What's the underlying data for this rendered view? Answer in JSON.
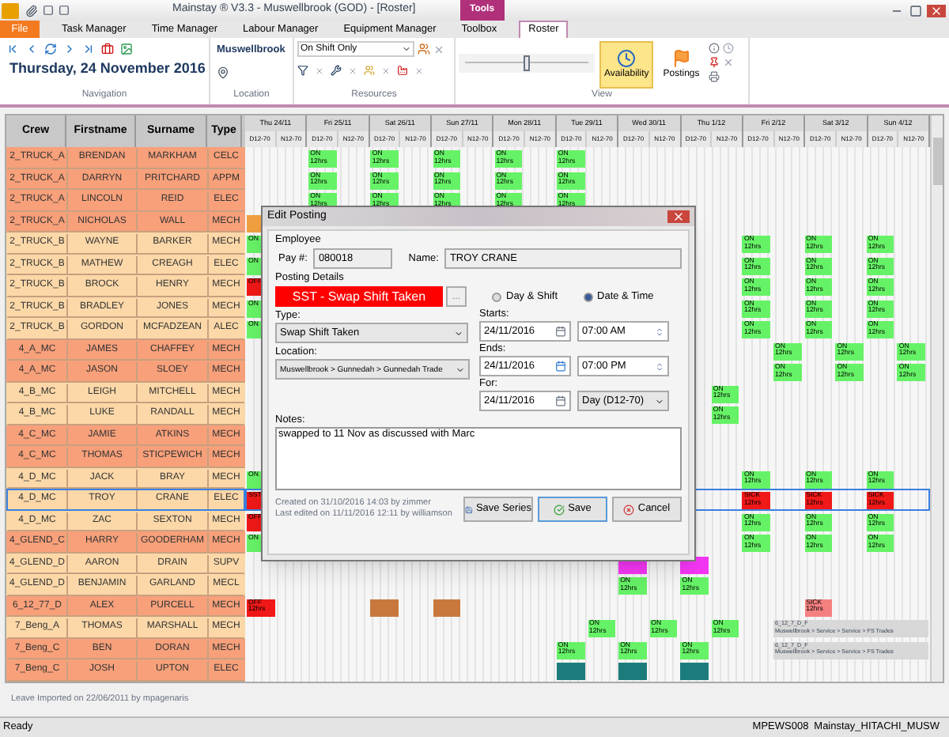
{
  "window": {
    "title": "Mainstay ® V3.3 - Muswellbrook (GOD) - [Roster]",
    "context_tab": "Tools"
  },
  "tabs": [
    {
      "label": "File",
      "kind": "file",
      "selected": false
    },
    {
      "label": "Task Manager",
      "kind": "tab",
      "selected": false
    },
    {
      "label": "Time Manager",
      "kind": "tab",
      "selected": false
    },
    {
      "label": "Labour Manager",
      "kind": "tab",
      "selected": false
    },
    {
      "label": "Equipment Manager",
      "kind": "tab",
      "selected": false
    },
    {
      "label": "Toolbox",
      "kind": "tab",
      "selected": false
    },
    {
      "label": "Roster",
      "kind": "tab",
      "selected": true
    }
  ],
  "ribbon": {
    "date": "Thursday, 24 November 2016",
    "location": "Muswellbrook",
    "resource_filter": "On Shift Only",
    "view_buttons": [
      {
        "label": "Availability",
        "selected": true
      },
      {
        "label": "Postings",
        "selected": false
      }
    ],
    "zoom_slider": {
      "level": 0.5
    },
    "groups": [
      "Navigation",
      "Location",
      "Resources",
      "View"
    ]
  },
  "table": {
    "columns": [
      "Crew",
      "Firstname",
      "Surname",
      "Type"
    ],
    "days": [
      {
        "label": "Thu 24/11",
        "shifts": [
          "D12-70",
          "N12-70"
        ]
      },
      {
        "label": "Fri 25/11",
        "shifts": [
          "D12-70",
          "N12-70"
        ]
      },
      {
        "label": "Sat 26/11",
        "shifts": [
          "D12-70",
          "N12-70"
        ]
      },
      {
        "label": "Sun 27/11",
        "shifts": [
          "D12-70",
          "N12-70"
        ]
      },
      {
        "label": "Mon 28/11",
        "shifts": [
          "D12-70",
          "N12-70"
        ]
      },
      {
        "label": "Tue 29/11",
        "shifts": [
          "D12-70",
          "N12-70"
        ]
      },
      {
        "label": "Wed 30/11",
        "shifts": [
          "D12-70",
          "N12-70"
        ]
      },
      {
        "label": "Thu 1/12",
        "shifts": [
          "D12-70",
          "N12-70"
        ]
      },
      {
        "label": "Fri 2/12",
        "shifts": [
          "D12-70",
          "N12-70"
        ]
      },
      {
        "label": "Sat 3/12",
        "shifts": [
          "D12-70",
          "N12-70"
        ]
      },
      {
        "label": "Sun 4/12",
        "shifts": [
          "D12-70",
          "N12-70"
        ]
      }
    ],
    "rows": [
      {
        "crew": "2_TRUCK_A",
        "firstname": "BRENDAN",
        "surname": "MARKHAM",
        "type": "CELC",
        "color": "#f7a07a",
        "selected": false,
        "cells": [
          null,
          null,
          {
            "kind": "on",
            "label": "ON 12hrs"
          },
          null,
          {
            "kind": "on",
            "label": "ON 12hrs"
          },
          null,
          {
            "kind": "on",
            "label": "ON 12hrs"
          },
          null,
          {
            "kind": "on",
            "label": "ON 12hrs"
          },
          null,
          {
            "kind": "on",
            "label": "ON 12hrs"
          },
          null,
          null,
          null,
          null,
          null,
          null,
          null,
          null,
          null,
          null,
          null
        ]
      },
      {
        "crew": "2_TRUCK_A",
        "firstname": "DARRYN",
        "surname": "PRITCHARD",
        "type": "APPM",
        "color": "#f7a07a",
        "selected": false,
        "cells": [
          null,
          null,
          {
            "kind": "on",
            "label": "ON 12hrs"
          },
          null,
          {
            "kind": "on",
            "label": "ON 12hrs"
          },
          null,
          {
            "kind": "on",
            "label": "ON 12hrs"
          },
          null,
          {
            "kind": "on",
            "label": "ON 12hrs"
          },
          null,
          {
            "kind": "on",
            "label": "ON 12hrs"
          },
          null,
          null,
          null,
          null,
          null,
          null,
          null,
          null,
          null,
          null,
          null
        ]
      },
      {
        "crew": "2_TRUCK_A",
        "firstname": "LINCOLN",
        "surname": "REID",
        "type": "ELEC",
        "color": "#f7a07a",
        "selected": false,
        "cells": [
          null,
          null,
          {
            "kind": "on",
            "label": "ON 12hrs"
          },
          null,
          {
            "kind": "on",
            "label": "ON 12hrs"
          },
          null,
          {
            "kind": "on",
            "label": "ON 12hrs"
          },
          null,
          {
            "kind": "on",
            "label": "ON 12hrs"
          },
          null,
          {
            "kind": "on",
            "label": "ON 12hrs"
          },
          null,
          null,
          null,
          null,
          null,
          null,
          null,
          null,
          null,
          null,
          null
        ]
      },
      {
        "crew": "2_TRUCK_A",
        "firstname": "NICHOLAS",
        "surname": "WALL",
        "type": "MECH",
        "color": "#f7a07a",
        "selected": false,
        "cells": [
          {
            "kind": "amber"
          },
          null,
          null,
          null,
          null,
          null,
          null,
          null,
          null,
          null,
          null,
          null,
          null,
          null,
          null,
          null,
          null,
          null,
          null,
          null,
          null,
          null
        ]
      },
      {
        "crew": "2_TRUCK_B",
        "firstname": "WAYNE",
        "surname": "BARKER",
        "type": "MECH",
        "color": "#fcd8a8",
        "selected": false,
        "cells": [
          {
            "kind": "on",
            "label": "ON"
          },
          null,
          null,
          null,
          null,
          null,
          null,
          null,
          null,
          null,
          null,
          null,
          null,
          null,
          null,
          null,
          {
            "kind": "on",
            "label": "ON 12hrs"
          },
          null,
          {
            "kind": "on",
            "label": "ON 12hrs"
          },
          null,
          {
            "kind": "on",
            "label": "ON 12hrs"
          },
          null
        ]
      },
      {
        "crew": "2_TRUCK_B",
        "firstname": "MATHEW",
        "surname": "CREAGH",
        "type": "ELEC",
        "color": "#fcd8a8",
        "selected": false,
        "cells": [
          {
            "kind": "on",
            "label": "ON"
          },
          null,
          null,
          null,
          null,
          null,
          null,
          null,
          null,
          null,
          null,
          null,
          null,
          null,
          null,
          null,
          {
            "kind": "on",
            "label": "ON 12hrs"
          },
          null,
          {
            "kind": "on",
            "label": "ON 12hrs"
          },
          null,
          {
            "kind": "on",
            "label": "ON 12hrs"
          },
          null
        ]
      },
      {
        "crew": "2_TRUCK_B",
        "firstname": "BROCK",
        "surname": "HENRY",
        "type": "MECH",
        "color": "#fcd8a8",
        "selected": false,
        "cells": [
          {
            "kind": "off",
            "label": "OFF"
          },
          null,
          null,
          null,
          null,
          null,
          null,
          null,
          null,
          null,
          null,
          null,
          null,
          null,
          null,
          null,
          {
            "kind": "on",
            "label": "ON 12hrs"
          },
          null,
          {
            "kind": "on",
            "label": "ON 12hrs"
          },
          null,
          {
            "kind": "on",
            "label": "ON 12hrs"
          },
          null
        ]
      },
      {
        "crew": "2_TRUCK_B",
        "firstname": "BRADLEY",
        "surname": "JONES",
        "type": "MECH",
        "color": "#fcd8a8",
        "selected": false,
        "cells": [
          {
            "kind": "on",
            "label": "ON"
          },
          null,
          null,
          null,
          null,
          null,
          null,
          null,
          null,
          null,
          null,
          null,
          null,
          null,
          null,
          null,
          {
            "kind": "on",
            "label": "ON 12hrs"
          },
          null,
          {
            "kind": "on",
            "label": "ON 12hrs"
          },
          null,
          {
            "kind": "on",
            "label": "ON 12hrs"
          },
          null
        ]
      },
      {
        "crew": "2_TRUCK_B",
        "firstname": "GORDON",
        "surname": "MCFADZEAN",
        "type": "ALEC",
        "color": "#fcd8a8",
        "selected": false,
        "cells": [
          {
            "kind": "on",
            "label": "ON"
          },
          null,
          null,
          null,
          null,
          null,
          null,
          null,
          null,
          null,
          null,
          null,
          null,
          null,
          null,
          null,
          {
            "kind": "on",
            "label": "ON 12hrs"
          },
          null,
          {
            "kind": "on",
            "label": "ON 12hrs"
          },
          null,
          {
            "kind": "on",
            "label": "ON 12hrs"
          },
          null
        ]
      },
      {
        "crew": "4_A_MC",
        "firstname": "JAMES",
        "surname": "CHAFFEY",
        "type": "MECH",
        "color": "#f7a07a",
        "selected": false,
        "cells": [
          null,
          null,
          null,
          null,
          null,
          null,
          null,
          null,
          null,
          null,
          null,
          null,
          null,
          null,
          null,
          null,
          null,
          {
            "kind": "on",
            "label": "ON 12hrs"
          },
          null,
          {
            "kind": "on",
            "label": "ON 12hrs"
          },
          null,
          {
            "kind": "on",
            "label": "ON 12hrs"
          }
        ]
      },
      {
        "crew": "4_A_MC",
        "firstname": "JASON",
        "surname": "SLOEY",
        "type": "MECH",
        "color": "#f7a07a",
        "selected": false,
        "cells": [
          null,
          null,
          null,
          null,
          null,
          null,
          null,
          null,
          null,
          null,
          null,
          null,
          null,
          null,
          null,
          null,
          null,
          {
            "kind": "on",
            "label": "ON 12hrs"
          },
          null,
          {
            "kind": "on",
            "label": "ON 12hrs"
          },
          null,
          {
            "kind": "on",
            "label": "ON 12hrs"
          }
        ]
      },
      {
        "crew": "4_B_MC",
        "firstname": "LEIGH",
        "surname": "MITCHELL",
        "type": "MECH",
        "color": "#fcd8a8",
        "selected": false,
        "cells": [
          null,
          null,
          null,
          null,
          null,
          null,
          null,
          null,
          null,
          null,
          null,
          null,
          null,
          null,
          null,
          {
            "kind": "on",
            "label": "ON 12hrs"
          },
          null,
          null,
          null,
          null,
          null,
          null
        ]
      },
      {
        "crew": "4_B_MC",
        "firstname": "LUKE",
        "surname": "RANDALL",
        "type": "MECH",
        "color": "#fcd8a8",
        "selected": false,
        "cells": [
          null,
          null,
          null,
          null,
          null,
          null,
          null,
          null,
          null,
          null,
          null,
          null,
          null,
          null,
          null,
          {
            "kind": "on",
            "label": "ON 12hrs"
          },
          null,
          null,
          null,
          null,
          null,
          null
        ]
      },
      {
        "crew": "4_C_MC",
        "firstname": "JAMIE",
        "surname": "ATKINS",
        "type": "MECH",
        "color": "#f7a07a",
        "selected": false,
        "cells": [
          null,
          null,
          null,
          null,
          null,
          null,
          null,
          null,
          null,
          null,
          null,
          null,
          null,
          null,
          null,
          null,
          null,
          null,
          null,
          null,
          null,
          null
        ]
      },
      {
        "crew": "4_C_MC",
        "firstname": "THOMAS",
        "surname": "STICPEWICH",
        "type": "MECH",
        "color": "#f7a07a",
        "selected": false,
        "cells": [
          null,
          null,
          null,
          null,
          null,
          null,
          null,
          null,
          null,
          null,
          null,
          null,
          null,
          null,
          null,
          null,
          null,
          null,
          null,
          null,
          null,
          null
        ]
      },
      {
        "crew": "4_D_MC",
        "firstname": "JACK",
        "surname": "BRAY",
        "type": "MECH",
        "color": "#fcd8a8",
        "selected": false,
        "cells": [
          {
            "kind": "on",
            "label": "ON"
          },
          null,
          null,
          null,
          null,
          null,
          null,
          null,
          null,
          null,
          null,
          null,
          null,
          null,
          null,
          null,
          {
            "kind": "on",
            "label": "ON 12hrs"
          },
          null,
          {
            "kind": "on",
            "label": "ON 12hrs"
          },
          null,
          {
            "kind": "on",
            "label": "ON 12hrs"
          },
          null
        ]
      },
      {
        "crew": "4_D_MC",
        "firstname": "TROY",
        "surname": "CRANE",
        "type": "ELEC",
        "color": "#fcd8a8",
        "selected": true,
        "cells": [
          {
            "kind": "off",
            "label": "SST"
          },
          null,
          null,
          null,
          null,
          null,
          null,
          null,
          null,
          null,
          null,
          null,
          null,
          null,
          null,
          null,
          {
            "kind": "off",
            "label": "SICK 12hrs"
          },
          null,
          {
            "kind": "off",
            "label": "SICK 12hrs"
          },
          null,
          {
            "kind": "off",
            "label": "SICK 12hrs"
          },
          null
        ]
      },
      {
        "crew": "4_D_MC",
        "firstname": "ZAC",
        "surname": "SEXTON",
        "type": "MECH",
        "color": "#fcd8a8",
        "selected": false,
        "cells": [
          {
            "kind": "off",
            "label": "OFF"
          },
          null,
          null,
          null,
          null,
          null,
          null,
          null,
          null,
          null,
          null,
          null,
          null,
          null,
          null,
          null,
          {
            "kind": "on",
            "label": "ON 12hrs"
          },
          null,
          {
            "kind": "on",
            "label": "ON 12hrs"
          },
          null,
          {
            "kind": "on",
            "label": "ON 12hrs"
          },
          null
        ]
      },
      {
        "crew": "4_GLEND_C",
        "firstname": "HARRY",
        "surname": "GOODERHAM",
        "type": "MECH",
        "color": "#f7a07a",
        "selected": false,
        "cells": [
          {
            "kind": "on",
            "label": "ON"
          },
          null,
          null,
          null,
          null,
          null,
          null,
          null,
          null,
          null,
          null,
          null,
          null,
          null,
          null,
          null,
          {
            "kind": "on",
            "label": "ON 12hrs"
          },
          null,
          {
            "kind": "on",
            "label": "ON 12hrs"
          },
          null,
          {
            "kind": "on",
            "label": "ON 12hrs"
          },
          null
        ]
      },
      {
        "crew": "4_GLEND_D",
        "firstname": "AARON",
        "surname": "DRAIN",
        "type": "SUPV",
        "color": "#fcd8a8",
        "selected": false,
        "cells": [
          null,
          null,
          null,
          null,
          null,
          null,
          null,
          null,
          null,
          null,
          null,
          null,
          {
            "kind": "leave"
          },
          null,
          {
            "kind": "leave"
          },
          null,
          null,
          null,
          null,
          null,
          null,
          null
        ]
      },
      {
        "crew": "4_GLEND_D",
        "firstname": "BENJAMIN",
        "surname": "GARLAND",
        "type": "MECL",
        "color": "#fcd8a8",
        "selected": false,
        "cells": [
          null,
          null,
          null,
          null,
          null,
          null,
          null,
          null,
          null,
          null,
          null,
          null,
          {
            "kind": "on",
            "label": "ON 12hrs"
          },
          null,
          {
            "kind": "on",
            "label": "ON 12hrs"
          },
          null,
          null,
          null,
          null,
          null,
          null,
          null
        ]
      },
      {
        "crew": "6_12_77_D",
        "firstname": "ALEX",
        "surname": "PURCELL",
        "type": "MECH",
        "color": "#f7a07a",
        "selected": false,
        "cells": [
          {
            "kind": "off",
            "label": "OFF 12hrs"
          },
          null,
          null,
          null,
          {
            "kind": "brown"
          },
          null,
          {
            "kind": "brown"
          },
          null,
          null,
          null,
          null,
          null,
          null,
          null,
          null,
          null,
          null,
          null,
          {
            "kind": "pink",
            "label": "SICK 12hrs"
          },
          null,
          null,
          null
        ]
      },
      {
        "crew": "7_Beng_A",
        "firstname": "THOMAS",
        "surname": "MARSHALL",
        "type": "MECH",
        "color": "#fcd8a8",
        "selected": false,
        "cells": [
          null,
          null,
          null,
          null,
          null,
          null,
          null,
          null,
          null,
          null,
          null,
          {
            "kind": "on",
            "label": "ON 12hrs"
          },
          null,
          {
            "kind": "on",
            "label": "ON 12hrs"
          },
          null,
          {
            "kind": "on",
            "label": "ON 12hrs"
          },
          null,
          {
            "kind": "note",
            "label": "6_12_7_D_F",
            "detail": "Muswellbrook > Service > Service > FS Trades"
          },
          null,
          null,
          null,
          null
        ]
      },
      {
        "crew": "7_Beng_C",
        "firstname": "BEN",
        "surname": "DORAN",
        "type": "MECH",
        "color": "#f7a07a",
        "selected": false,
        "cells": [
          null,
          null,
          null,
          null,
          null,
          null,
          null,
          null,
          null,
          null,
          {
            "kind": "on",
            "label": "ON 12hrs"
          },
          null,
          {
            "kind": "on",
            "label": "ON 12hrs"
          },
          null,
          {
            "kind": "on",
            "label": "ON 12hrs"
          },
          null,
          null,
          {
            "kind": "note",
            "label": "6_12_7_D_F",
            "detail": "Muswellbrook > Service > Service > FS Trades"
          },
          null,
          null,
          null,
          null
        ]
      },
      {
        "crew": "7_Beng_C",
        "firstname": "JOSH",
        "surname": "UPTON",
        "type": "ELEC",
        "color": "#f7a07a",
        "selected": false,
        "cells": [
          null,
          null,
          null,
          null,
          null,
          null,
          null,
          null,
          null,
          null,
          {
            "kind": "teal"
          },
          null,
          {
            "kind": "teal"
          },
          null,
          {
            "kind": "teal"
          },
          null,
          null,
          null,
          null,
          null,
          null,
          null
        ]
      }
    ],
    "footer": "Leave Imported on 22/06/2011 by mpagenaris"
  },
  "dialog": {
    "title": "Edit Posting",
    "employee_label": "Employee",
    "pay_label": "Pay #:",
    "pay": "080018",
    "name_label": "Name:",
    "name": "TROY CRANE",
    "details_label": "Posting Details",
    "code": "SST - Swap Shift Taken",
    "more_button": "...",
    "modes": [
      {
        "label": "Day & Shift",
        "selected": false
      },
      {
        "label": "Date & Time",
        "selected": true
      }
    ],
    "type_label": "Type:",
    "type": "Swap Shift Taken",
    "location_label": "Location:",
    "location": "Muswellbrook > Gunnedah > Gunnedah Trade",
    "starts_label": "Starts:",
    "starts_date": "24/11/2016",
    "starts_time": "07:00 AM",
    "ends_label": "Ends:",
    "ends_date": "24/11/2016",
    "ends_time": "07:00 PM",
    "for_label": "For:",
    "for_date": "24/11/2016",
    "for_shift": "Day (D12-70)",
    "notes_label": "Notes:",
    "notes": "swapped to 11 Nov as discussed with Marc",
    "created": "Created on 31/10/2016 14:03 by zimmer",
    "edited": "Last edited on 11/11/2016 12:11 by williamson",
    "buttons": [
      {
        "label": "Save Series",
        "kind": "series",
        "focused": false
      },
      {
        "label": "Save",
        "kind": "save",
        "focused": true
      },
      {
        "label": "Cancel",
        "kind": "cancel",
        "focused": false
      }
    ]
  },
  "status_bar": [
    "Ready",
    "MPEWS008",
    "Mainstay_HITACHI_MUSW"
  ]
}
